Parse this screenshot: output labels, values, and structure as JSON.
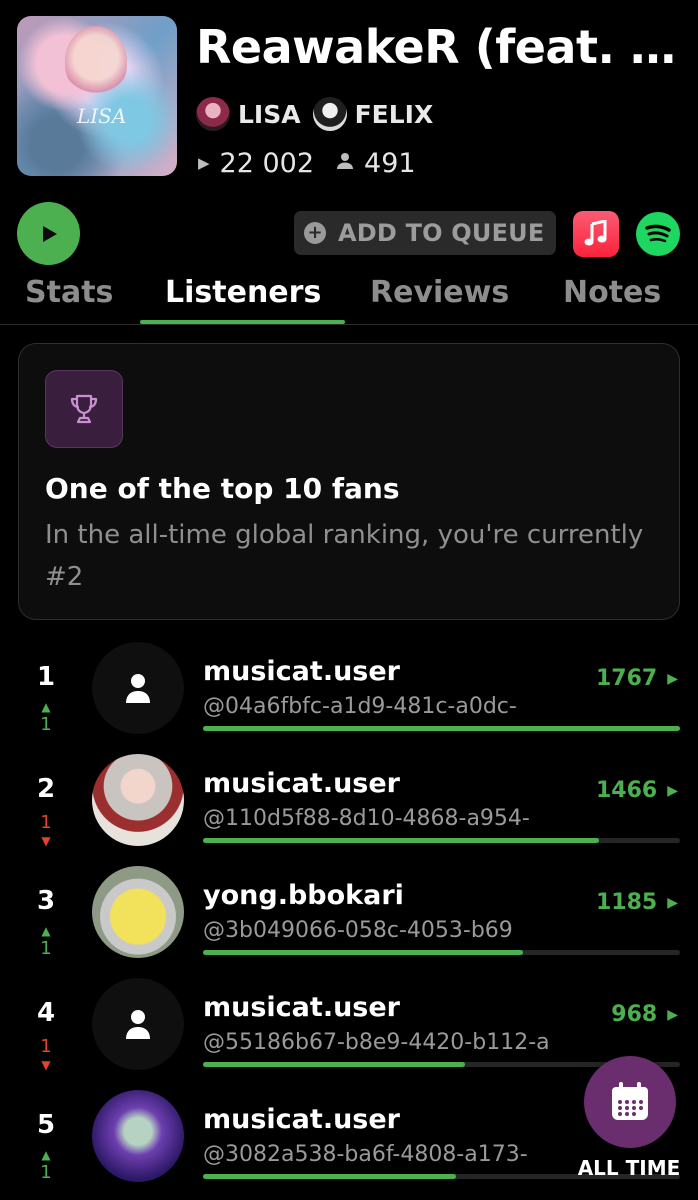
{
  "track": {
    "title": "ReawakeR (feat. FELIX of Stray Kids)",
    "cover_text": "LISA",
    "artists": [
      {
        "name": "LISA",
        "avatar": "lisa-avatar"
      },
      {
        "name": "FELIX",
        "avatar": "felix-avatar"
      }
    ],
    "plays": "22 002",
    "listeners": "491"
  },
  "actions": {
    "add_to_queue_label": "ADD TO QUEUE",
    "play_icon": "play-icon",
    "apple_music_icon": "apple-music-icon",
    "spotify_icon": "spotify-icon"
  },
  "tabs": [
    {
      "label": "Stats",
      "active": false
    },
    {
      "label": "Listeners",
      "active": true
    },
    {
      "label": "Reviews",
      "active": false
    },
    {
      "label": "Notes",
      "active": false
    }
  ],
  "fan_card": {
    "icon": "trophy-icon",
    "title": "One of the top 10 fans",
    "description": "In the all-time global ranking, you're currently #2"
  },
  "listeners": [
    {
      "rank": "1",
      "change": "1",
      "direction": "up",
      "name": "musicat.user",
      "handle": "@04a6fbfc-a1d9-481c-a0dc-",
      "score": "1767",
      "fraction": 1.0,
      "avatar": "default"
    },
    {
      "rank": "2",
      "change": "1",
      "direction": "down",
      "name": "musicat.user",
      "handle": "@110d5f88-8d10-4868-a954-",
      "score": "1466",
      "fraction": 0.83,
      "avatar": "photo-boy"
    },
    {
      "rank": "3",
      "change": "1",
      "direction": "up",
      "name": "yong.bbokari",
      "handle": "@3b049066-058c-4053-b69",
      "score": "1185",
      "fraction": 0.67,
      "avatar": "photo-duck"
    },
    {
      "rank": "4",
      "change": "1",
      "direction": "down",
      "name": "musicat.user",
      "handle": "@55186b67-b8e9-4420-b112-a",
      "score": "968",
      "fraction": 0.55,
      "avatar": "default"
    },
    {
      "rank": "5",
      "change": "1",
      "direction": "up",
      "name": "musicat.user",
      "handle": "@3082a538-ba6f-4808-a173-",
      "score": "",
      "fraction": 0.53,
      "avatar": "photo-stage"
    }
  ],
  "filter": {
    "label": "ALL TIME",
    "icon": "calendar-icon"
  },
  "colors": {
    "accent": "#4caf50",
    "down": "#e0442f",
    "fab": "#6a2d6e"
  }
}
